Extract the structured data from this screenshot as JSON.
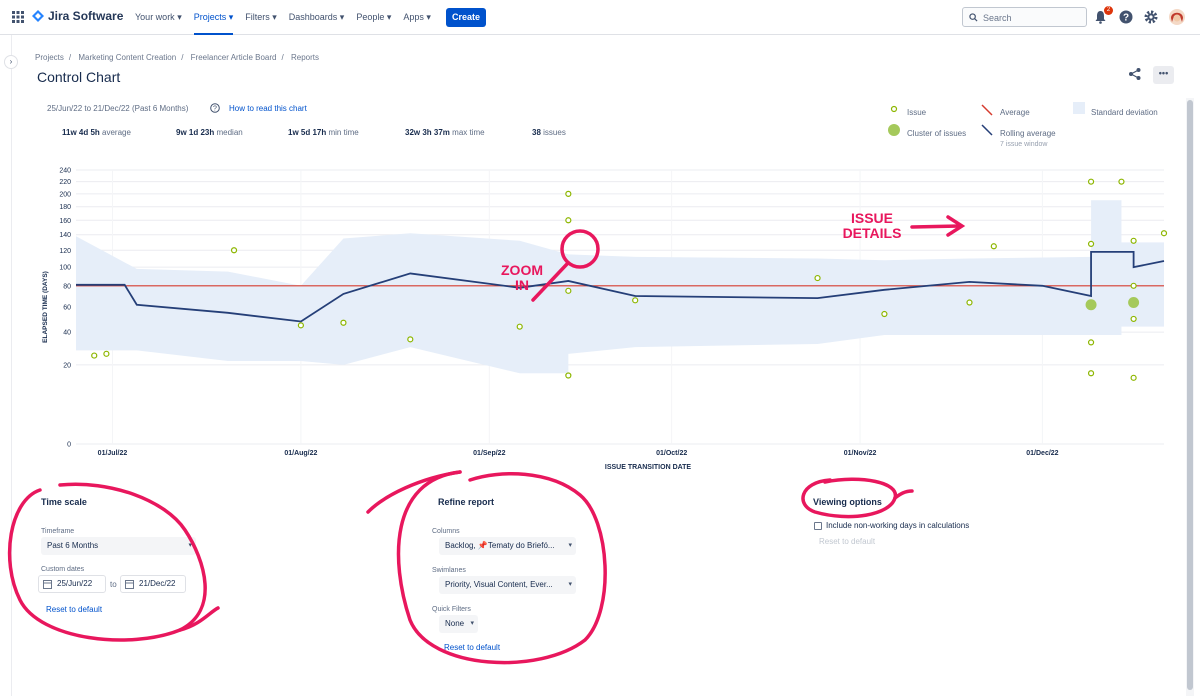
{
  "nav": {
    "logo": "Jira Software",
    "menu": [
      {
        "label": "Your work ▾"
      },
      {
        "label": "Projects ▾"
      },
      {
        "label": "Filters ▾"
      },
      {
        "label": "Dashboards ▾"
      },
      {
        "label": "People ▾"
      },
      {
        "label": "Apps ▾"
      }
    ],
    "create": "Create",
    "search_placeholder": "Search",
    "notification_count": "2",
    "accent": "#0052cc"
  },
  "breadcrumb": [
    "Projects",
    "Marketing Content Creation",
    "Freelancer Article Board",
    "Reports"
  ],
  "page_title": "Control Chart",
  "report": {
    "date_range": "25/Jun/22 to 21/Dec/22 (Past 6 Months)",
    "how_to": "How to read this chart",
    "stats": [
      {
        "value": "11w 4d 5h",
        "label": "average"
      },
      {
        "value": "9w 1d 23h",
        "label": "median"
      },
      {
        "value": "1w 5d 17h",
        "label": "min time"
      },
      {
        "value": "32w 3h 37m",
        "label": "max time"
      },
      {
        "value": "38",
        "label": "issues"
      }
    ],
    "legend": {
      "issue": "Issue",
      "cluster": "Cluster of issues",
      "average": "Average",
      "rolling": "Rolling average",
      "rolling_note": "7 issue window",
      "std": "Standard deviation"
    }
  },
  "chart_data": {
    "type": "scatter",
    "ylabel": "ELAPSED TIME (DAYS)",
    "xlabel": "ISSUE TRANSITION DATE",
    "y_ticks": [
      0,
      20,
      40,
      60,
      80,
      100,
      120,
      140,
      160,
      180,
      200,
      220,
      240
    ],
    "x_ticks": [
      "01/Jul/22",
      "01/Aug/22",
      "01/Sep/22",
      "01/Oct/22",
      "01/Nov/22",
      "01/Dec/22"
    ],
    "average": 80,
    "issues": [
      {
        "x": "2022-06-28",
        "y": 25
      },
      {
        "x": "2022-06-30",
        "y": 26
      },
      {
        "x": "2022-07-21",
        "y": 120
      },
      {
        "x": "2022-08-01",
        "y": 45
      },
      {
        "x": "2022-08-08",
        "y": 47
      },
      {
        "x": "2022-08-19",
        "y": 35
      },
      {
        "x": "2022-09-06",
        "y": 44
      },
      {
        "x": "2022-09-14",
        "y": 200
      },
      {
        "x": "2022-09-14",
        "y": 160
      },
      {
        "x": "2022-09-14",
        "y": 75
      },
      {
        "x": "2022-09-14",
        "y": 15
      },
      {
        "x": "2022-09-25",
        "y": 66
      },
      {
        "x": "2022-10-25",
        "y": 88
      },
      {
        "x": "2022-11-05",
        "y": 54
      },
      {
        "x": "2022-11-19",
        "y": 64
      },
      {
        "x": "2022-11-23",
        "y": 125
      },
      {
        "x": "2022-12-09",
        "y": 220
      },
      {
        "x": "2022-12-09",
        "y": 128
      },
      {
        "x": "2022-12-09",
        "y": 33
      },
      {
        "x": "2022-12-09",
        "y": 16
      },
      {
        "x": "2022-12-14",
        "y": 220
      },
      {
        "x": "2022-12-16",
        "y": 132
      },
      {
        "x": "2022-12-16",
        "y": 80
      },
      {
        "x": "2022-12-16",
        "y": 50
      },
      {
        "x": "2022-12-16",
        "y": 14
      },
      {
        "x": "2022-12-21",
        "y": 142
      }
    ],
    "clusters": [
      {
        "x": "2022-12-09",
        "y": 62
      },
      {
        "x": "2022-12-16",
        "y": 64
      }
    ],
    "rolling_average": [
      {
        "x": "2022-06-25",
        "y": 81
      },
      {
        "x": "2022-07-03",
        "y": 81
      },
      {
        "x": "2022-07-05",
        "y": 62
      },
      {
        "x": "2022-07-20",
        "y": 55
      },
      {
        "x": "2022-08-01",
        "y": 48
      },
      {
        "x": "2022-08-08",
        "y": 72
      },
      {
        "x": "2022-08-19",
        "y": 93
      },
      {
        "x": "2022-09-06",
        "y": 78
      },
      {
        "x": "2022-09-14",
        "y": 85
      },
      {
        "x": "2022-09-25",
        "y": 70
      },
      {
        "x": "2022-10-25",
        "y": 68
      },
      {
        "x": "2022-11-05",
        "y": 76
      },
      {
        "x": "2022-11-19",
        "y": 84
      },
      {
        "x": "2022-12-01",
        "y": 80
      },
      {
        "x": "2022-12-09",
        "y": 70
      },
      {
        "x": "2022-12-09",
        "y": 118
      },
      {
        "x": "2022-12-16",
        "y": 118
      },
      {
        "x": "2022-12-16",
        "y": 100
      },
      {
        "x": "2022-12-21",
        "y": 107
      }
    ],
    "std_dev_band": [
      {
        "x": "2022-06-25",
        "low": 28,
        "high": 138
      },
      {
        "x": "2022-07-05",
        "low": 28,
        "high": 98
      },
      {
        "x": "2022-07-20",
        "low": 22,
        "high": 95
      },
      {
        "x": "2022-08-01",
        "low": 22,
        "high": 80
      },
      {
        "x": "2022-08-08",
        "low": 20,
        "high": 135
      },
      {
        "x": "2022-08-19",
        "low": 30,
        "high": 142
      },
      {
        "x": "2022-09-06",
        "low": 16,
        "high": 132
      },
      {
        "x": "2022-09-14",
        "low": 16,
        "high": 115
      },
      {
        "x": "2022-09-14",
        "low": 26,
        "high": 115
      },
      {
        "x": "2022-09-25",
        "low": 30,
        "high": 112
      },
      {
        "x": "2022-10-25",
        "low": 32,
        "high": 110
      },
      {
        "x": "2022-11-05",
        "low": 38,
        "high": 108
      },
      {
        "x": "2022-11-19",
        "low": 38,
        "high": 110
      },
      {
        "x": "2022-12-09",
        "low": 38,
        "high": 112
      },
      {
        "x": "2022-12-09",
        "low": 38,
        "high": 190
      },
      {
        "x": "2022-12-14",
        "low": 38,
        "high": 190
      },
      {
        "x": "2022-12-14",
        "low": 44,
        "high": 130
      },
      {
        "x": "2022-12-21",
        "low": 44,
        "high": 130
      }
    ]
  },
  "time_scale": {
    "title": "Time scale",
    "timeframe_label": "Timeframe",
    "timeframe_value": "Past 6 Months",
    "custom_label": "Custom dates",
    "from": "25/Jun/22",
    "to_word": "to",
    "to": "21/Dec/22",
    "reset": "Reset to default"
  },
  "refine": {
    "title": "Refine report",
    "columns_label": "Columns",
    "columns_value": "Backlog, 📌Tematy do Briefó...",
    "swimlanes_label": "Swimlanes",
    "swimlanes_value": "Priority, Visual Content, Ever...",
    "quick_label": "Quick Filters",
    "quick_value": "None",
    "reset": "Reset to default"
  },
  "viewing": {
    "title": "Viewing options",
    "nonworking": "Include non-working days in calculations",
    "reset": "Reset to default"
  },
  "annotations": {
    "issue_details": "ISSUE\nDETAILS",
    "zoom_in": "ZOOM\nIN",
    "color": "#e8175d"
  }
}
